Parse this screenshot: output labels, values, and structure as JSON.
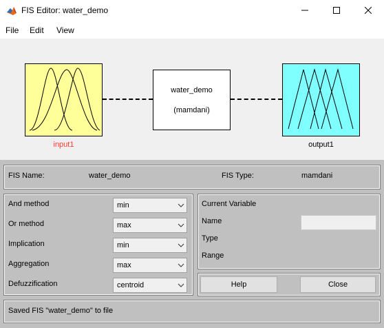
{
  "window": {
    "title": "FIS Editor: water_demo",
    "controls": {
      "minimize": "minimize-icon",
      "maximize": "maximize-icon",
      "close": "close-icon"
    }
  },
  "menu": {
    "items": [
      "File",
      "Edit",
      "View"
    ]
  },
  "diagram": {
    "input_label": "input1",
    "output_label": "output1",
    "system_name": "water_demo",
    "system_type": "(mamdani)",
    "colors": {
      "input_box": "#ffff99",
      "output_box": "#80ffff",
      "input_label": "#ff3333",
      "background": "#f0f0f0"
    }
  },
  "fis_info": {
    "name_label": "FIS Name:",
    "name_value": "water_demo",
    "type_label": "FIS Type:",
    "type_value": "mamdani"
  },
  "methods": [
    {
      "label": "And method",
      "value": "min"
    },
    {
      "label": "Or method",
      "value": "max"
    },
    {
      "label": "Implication",
      "value": "min"
    },
    {
      "label": "Aggregation",
      "value": "max"
    },
    {
      "label": "Defuzzification",
      "value": "centroid"
    }
  ],
  "current_variable": {
    "title": "Current Variable",
    "name_label": "Name",
    "name_value": "",
    "type_label": "Type",
    "range_label": "Range"
  },
  "buttons": {
    "help": "Help",
    "close": "Close"
  },
  "status": "Saved FIS \"water_demo\" to file"
}
